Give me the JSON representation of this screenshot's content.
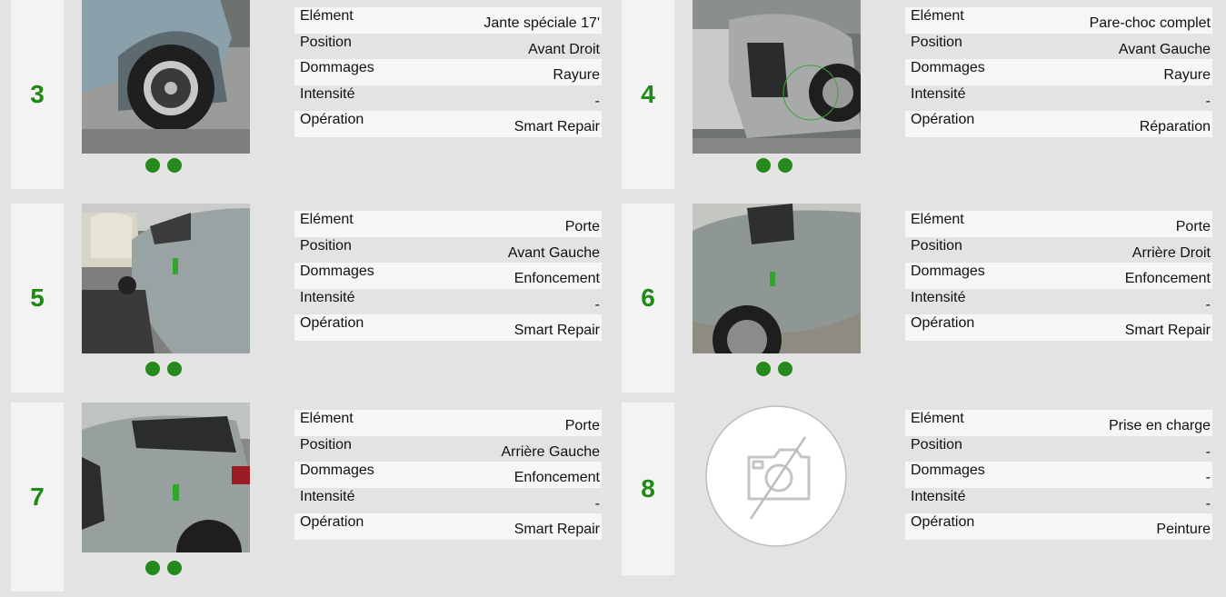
{
  "cards": [
    {
      "number": "3",
      "rows": [
        {
          "label": "Elément",
          "value": "Jante spéciale 17'"
        },
        {
          "label": "Position",
          "value": "Avant Droit"
        },
        {
          "label": "Dommages",
          "value": "Rayure"
        },
        {
          "label": "Intensité",
          "value": "-"
        },
        {
          "label": "Opération",
          "value": "Smart Repair"
        }
      ]
    },
    {
      "number": "4",
      "rows": [
        {
          "label": "Elément",
          "value": "Pare-choc complet"
        },
        {
          "label": "Position",
          "value": "Avant Gauche"
        },
        {
          "label": "Dommages",
          "value": "Rayure"
        },
        {
          "label": "Intensité",
          "value": "-"
        },
        {
          "label": "Opération",
          "value": "Réparation"
        }
      ]
    },
    {
      "number": "5",
      "rows": [
        {
          "label": "Elément",
          "value": "Porte"
        },
        {
          "label": "Position",
          "value": "Avant Gauche"
        },
        {
          "label": "Dommages",
          "value": "Enfoncement"
        },
        {
          "label": "Intensité",
          "value": "-"
        },
        {
          "label": "Opération",
          "value": "Smart Repair"
        }
      ]
    },
    {
      "number": "6",
      "rows": [
        {
          "label": "Elément",
          "value": "Porte"
        },
        {
          "label": "Position",
          "value": "Arrière Droit"
        },
        {
          "label": "Dommages",
          "value": "Enfoncement"
        },
        {
          "label": "Intensité",
          "value": "-"
        },
        {
          "label": "Opération",
          "value": "Smart Repair"
        }
      ]
    },
    {
      "number": "7",
      "rows": [
        {
          "label": "Elément",
          "value": "Porte"
        },
        {
          "label": "Position",
          "value": "Arrière Gauche"
        },
        {
          "label": "Dommages",
          "value": "Enfoncement"
        },
        {
          "label": "Intensité",
          "value": "-"
        },
        {
          "label": "Opération",
          "value": "Smart Repair"
        }
      ]
    },
    {
      "number": "8",
      "rows": [
        {
          "label": "Elément",
          "value": "Prise en charge"
        },
        {
          "label": "Position",
          "value": "-"
        },
        {
          "label": "Dommages",
          "value": "-"
        },
        {
          "label": "Intensité",
          "value": "-"
        },
        {
          "label": "Opération",
          "value": "Peinture"
        }
      ]
    }
  ],
  "colors": {
    "accent": "#1e8a14",
    "dot": "#238a1b",
    "background": "#e3e3e3",
    "panel": "#f3f3f3"
  }
}
